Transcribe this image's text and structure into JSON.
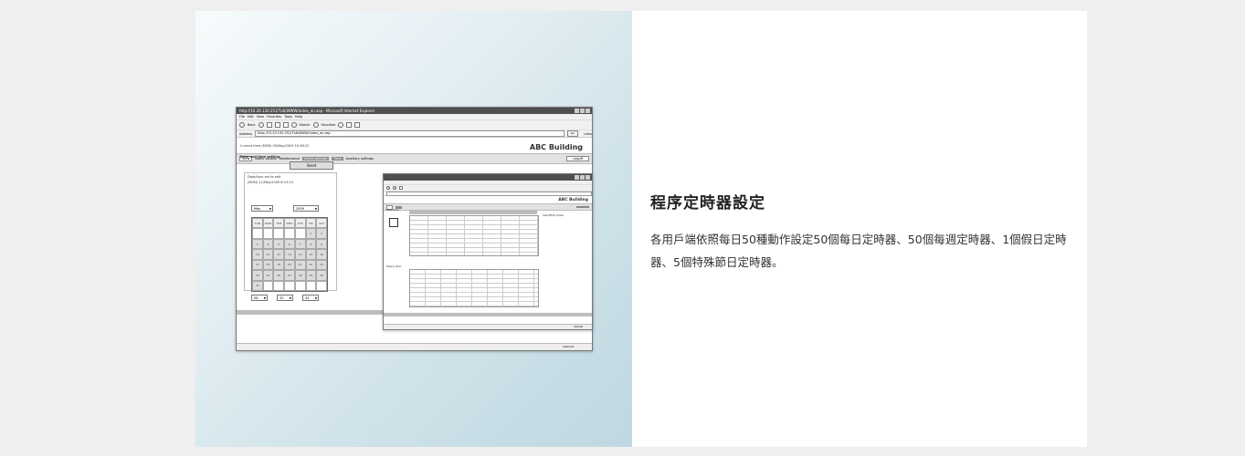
{
  "feature": {
    "title": "程序定時器設定",
    "description": "各用戶端依照每日50種動作設定50個每日定時器、50個每週定時器、1個假日定時器、5個特殊節日定時器。"
  },
  "screenshot": {
    "window1": {
      "titlebar": "http://10.20.130.251/Tx6/WWW/index_en.asp - Microsoft Internet Explorer",
      "menu": "File  Edit  View  Favorites  Tools  Help",
      "toolbar": {
        "back": "Back",
        "search": "Search",
        "favorites": "Favorites"
      },
      "address_label": "Address",
      "address": "http://10.20.130.251/Tx6/WWW/index_en.asp",
      "go": "Go",
      "links": "Links",
      "app_title": "ABC Building",
      "nav": {
        "view": "View",
        "batch_control": "Batch control",
        "maintenance": "Maintenance",
        "initial_settings": "Initial settings",
        "time": "Time",
        "auxiliary_settings": "Auxiliary settings",
        "logout": "Logoff"
      },
      "current_time": "Current time (MON) 05/May/2009 10:36:22",
      "date_time_setting": "Date and time setting",
      "send": "Send",
      "database_label": "Date/hour set to edit",
      "database_value": "(MON) 11/May/2009 8:13:24",
      "month": "May",
      "year": "2009",
      "weekdays": [
        "SUN",
        "MON",
        "TUE",
        "WED",
        "THU",
        "FRI",
        "SAT"
      ],
      "days": [
        "",
        "",
        "",
        "",
        "",
        "1",
        "2",
        "3",
        "4",
        "5",
        "6",
        "7",
        "8",
        "9",
        "10",
        "11",
        "12",
        "13",
        "14",
        "15",
        "16",
        "17",
        "18",
        "19",
        "20",
        "21",
        "22",
        "23",
        "24",
        "25",
        "26",
        "27",
        "28",
        "29",
        "30",
        "31",
        "",
        "",
        "",
        "",
        "",
        ""
      ],
      "hour": "08",
      "minute": "32",
      "second": "45",
      "status_zone": "Internet"
    },
    "window2": {
      "app_title": "ABC Building",
      "side_label": "Daily timer",
      "right_label": "Select/Edit update",
      "sub_label": "Weekly timer",
      "status_zone": "Internet"
    }
  }
}
